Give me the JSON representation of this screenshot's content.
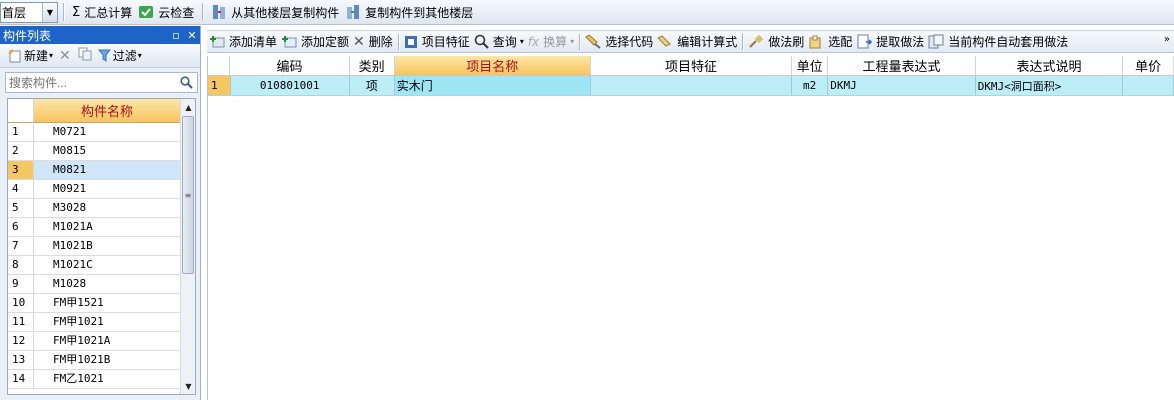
{
  "top_toolbar": {
    "floor_value": "首层",
    "sum_calc": "汇总计算",
    "cloud_check": "云检查",
    "copy_from_floor": "从其他楼层复制构件",
    "copy_to_floor": "复制构件到其他楼层"
  },
  "left_panel": {
    "title": "构件列表",
    "new_label": "新建",
    "filter_label": "过滤",
    "search_placeholder": "搜索构件...",
    "column_header": "构件名称",
    "rows": [
      {
        "num": "1",
        "name": "M0721"
      },
      {
        "num": "2",
        "name": "M0815"
      },
      {
        "num": "3",
        "name": "M0821"
      },
      {
        "num": "4",
        "name": "M0921"
      },
      {
        "num": "5",
        "name": "M3028"
      },
      {
        "num": "6",
        "name": "M1021A"
      },
      {
        "num": "7",
        "name": "M1021B"
      },
      {
        "num": "8",
        "name": "M1021C"
      },
      {
        "num": "9",
        "name": "M1028"
      },
      {
        "num": "10",
        "name": "FM甲1521"
      },
      {
        "num": "11",
        "name": "FM甲1021"
      },
      {
        "num": "12",
        "name": "FM甲1021A"
      },
      {
        "num": "13",
        "name": "FM甲1021B"
      },
      {
        "num": "14",
        "name": "FM乙1021"
      }
    ],
    "selected_row": "3"
  },
  "right_toolbar": {
    "add_list": "添加清单",
    "add_quota": "添加定额",
    "delete": "删除",
    "item_feature": "项目特征",
    "query": "查询",
    "convert": "换算",
    "select_code": "选择代码",
    "edit_formula": "编辑计算式",
    "method_brush": "做法刷",
    "match": "选配",
    "extract_method": "提取做法",
    "auto_apply": "当前构件自动套用做法"
  },
  "grid": {
    "headers": [
      "编码",
      "类别",
      "项目名称",
      "项目特征",
      "单位",
      "工程量表达式",
      "表达式说明",
      "单价"
    ],
    "rows": [
      {
        "num": "1",
        "code": "010801001",
        "type": "项",
        "name": "实木门",
        "feature": "",
        "unit": "m2",
        "expr": "DKMJ",
        "expr_desc": "DKMJ<洞口面积>",
        "price": ""
      }
    ]
  },
  "colors": {
    "title_bar": "#1e64c8",
    "selected_header": "#f7c35f",
    "row_highlight": "#bdeef7",
    "header_text_active": "#b01010"
  }
}
